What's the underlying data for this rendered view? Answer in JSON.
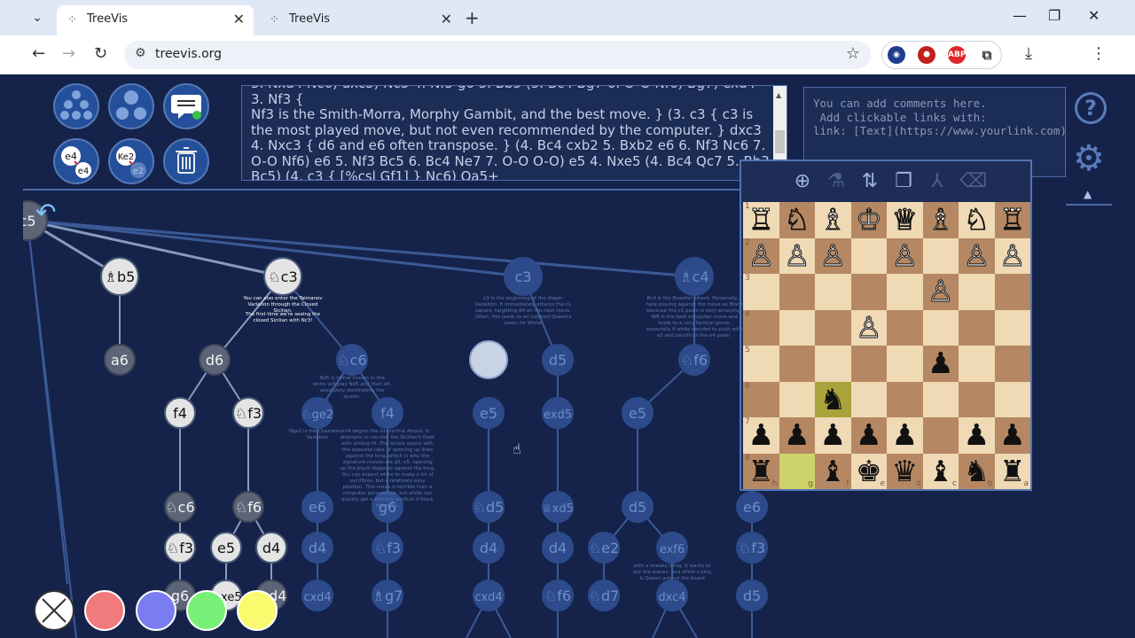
{
  "browser": {
    "tabs": [
      {
        "title": "TreeVis",
        "active": true
      },
      {
        "title": "TreeVis",
        "active": false
      }
    ],
    "url": "treevis.org",
    "window_controls": [
      "minimize-icon",
      "restore-icon",
      "close-icon"
    ],
    "extensions": [
      "privacy-badger-icon",
      "ublock-icon",
      "adblock-plus-icon",
      "puzzle-extensions-icon"
    ]
  },
  "app": {
    "toolbar": [
      {
        "name": "tree-layout-icon"
      },
      {
        "name": "bubble-layout-icon"
      },
      {
        "name": "comments-toggle-icon"
      },
      {
        "name": "e4-e4-icon",
        "label_a": "e4",
        "label_b": "e4"
      },
      {
        "name": "ke2-e2-icon",
        "label_a": "Ke2",
        "label_b": "e2"
      },
      {
        "name": "trash-icon"
      }
    ],
    "pgn_text_hidden_line": "3. Nxd4 Nc6) dxc3) Nc3 4. Nf3 g6 5. Bb5 (5. Bc4 Bg7 6. O-O Nf6) Bg7) exd4 3. Nf3 {",
    "pgn_text": "Nf3 is the Smith-Morra, Morphy Gambit, and the best move. } (3. c3 { c3 is the most played move, but not even recommended by the computer. } dxc3 4. Nxc3 { d6 and e6 often transpose. } (4. Bc4 cxb2 5. Bxb2 e6 6. Nf3 Nc6 7. O-O Nf6) e6 5. Nf3 Bc5 6. Bc4 Ne7 7. O-O O-O) e5 4. Nxe5 (4. Bc4 Qc7 5. Bb3 Bc5) (4. c3 { [%csl Gf1] } Nc6) Qa5+",
    "comment_placeholder": "You can add comments here.\n Add clickable links with:\nlink: [Text](https://www.yourlink.com)",
    "help_label": "?",
    "tree": {
      "root_label": "c5",
      "nodes": [
        {
          "id": "n1",
          "label": "♗b5",
          "style": "w"
        },
        {
          "id": "n2",
          "label": "♘c3",
          "style": "w"
        },
        {
          "id": "n3",
          "label": "c3",
          "style": "f"
        },
        {
          "id": "n4",
          "label": "♗c4",
          "style": "f"
        },
        {
          "id": "n5",
          "label": "a6",
          "style": "d"
        },
        {
          "id": "n6",
          "label": "d6",
          "style": "d"
        },
        {
          "id": "n7",
          "label": "♘c6",
          "style": "f"
        },
        {
          "id": "n8",
          "label": "d5",
          "style": "f"
        },
        {
          "id": "n9",
          "label": "♘f6",
          "style": "f"
        },
        {
          "id": "n10",
          "label": "f4",
          "style": "w"
        },
        {
          "id": "n11",
          "label": "♘f3",
          "style": "w"
        },
        {
          "id": "n12",
          "label": "♘ge2",
          "style": "f"
        },
        {
          "id": "n13",
          "label": "f4",
          "style": "f"
        },
        {
          "id": "n14",
          "label": "e5",
          "style": "f"
        },
        {
          "id": "n15",
          "label": "exd5",
          "style": "f"
        },
        {
          "id": "n16",
          "label": "e5",
          "style": "f"
        },
        {
          "id": "n17",
          "label": "♘c6",
          "style": "d"
        },
        {
          "id": "n18",
          "label": "♘f6",
          "style": "d"
        },
        {
          "id": "n19",
          "label": "e6",
          "style": "f"
        },
        {
          "id": "n20",
          "label": "g6",
          "style": "f"
        },
        {
          "id": "n21",
          "label": "♘d5",
          "style": "f"
        },
        {
          "id": "n22",
          "label": "♕xd5",
          "style": "f"
        },
        {
          "id": "n23",
          "label": "d5",
          "style": "f"
        },
        {
          "id": "n24",
          "label": "e6",
          "style": "f"
        },
        {
          "id": "n25",
          "label": "♘f3",
          "style": "w"
        },
        {
          "id": "n26",
          "label": "e5",
          "style": "w"
        },
        {
          "id": "n27",
          "label": "d4",
          "style": "w"
        },
        {
          "id": "n28",
          "label": "d4",
          "style": "f"
        },
        {
          "id": "n29",
          "label": "♘f3",
          "style": "f"
        },
        {
          "id": "n30",
          "label": "d4",
          "style": "f"
        },
        {
          "id": "n31",
          "label": "d4",
          "style": "f"
        },
        {
          "id": "n32",
          "label": "♘e2",
          "style": "f"
        },
        {
          "id": "n33",
          "label": "exf6",
          "style": "f"
        },
        {
          "id": "n34",
          "label": "♘f3",
          "style": "f"
        },
        {
          "id": "n35",
          "label": "g6",
          "style": "d"
        },
        {
          "id": "n36",
          "label": "♘xe5",
          "style": "w"
        },
        {
          "id": "n37",
          "label": "♘d4",
          "style": "d"
        },
        {
          "id": "n38",
          "label": "cxd4",
          "style": "f"
        },
        {
          "id": "n39",
          "label": "♗g7",
          "style": "f"
        },
        {
          "id": "n40",
          "label": "cxd4",
          "style": "f"
        },
        {
          "id": "n41",
          "label": "♘f6",
          "style": "f"
        },
        {
          "id": "n42",
          "label": "♘d7",
          "style": "f"
        },
        {
          "id": "n43",
          "label": "dxc4",
          "style": "f"
        },
        {
          "id": "n44",
          "label": "d5",
          "style": "f"
        }
      ],
      "annotations": [
        {
          "id": "a1",
          "text": "You can also enter the Taimanov Variation through the Closed Sicilian."
        },
        {
          "id": "a2",
          "text": "The first time we're seeing the closed Sicilian with Nc3!"
        },
        {
          "id": "a3",
          "text": "c3 is the beginning of the Alapin Variation. It immediately attacks the c1 square, targeting d4 on the next move. Often, this leads to an isolated Queen's pawn for White"
        },
        {
          "id": "a4",
          "text": "Bc4 is the Bowdler attack. Personally, I hate playing against the move as Black because the c5 pawn is very annoying. Nf6 is the best computer move and leads to a very tactical game, especially if white decides to push with e5 and sacrifices the e4 pawn."
        },
        {
          "id": "a5",
          "text": "Nd5 is rather known in the white will play Nd5 and then d4, absolutely dominating the queen."
        },
        {
          "id": "a6",
          "text": "Nge2 is the Chameleon Variation"
        },
        {
          "id": "a7",
          "text": "f4 begins the Grand Prix Attack. It attempts to counter the Sicilian's flank with aiming f4. The attack opens with the opposite idea of opening up lines against the king, which is why the signature moves are g5, e5, opening up the black diagonal against the king. You can expect white to make a lot of sacrifices, but a relatively easy position. This move is terrible from a computer perspective, but white can quickly get a winning position if black misplays."
        },
        {
          "id": "a8",
          "text": "with a sneaky thing. It wants to put the pieces, and white's king & Queen around the board"
        }
      ]
    },
    "chess_tools": [
      "zoom-in-icon",
      "analysis-microscope-icon",
      "flip-board-icon",
      "copy-fen-icon",
      "branch-icon",
      "delete-branch-icon"
    ],
    "board_ranks": [
      "1",
      "2",
      "3",
      "4",
      "5",
      "6",
      "7",
      "8"
    ],
    "board_files": [
      "h",
      "g",
      "f",
      "e",
      "d",
      "c",
      "b",
      "a"
    ],
    "board": [
      [
        "♖",
        "♘",
        "♗",
        "♔",
        "♕",
        "♗",
        "♘",
        "♖"
      ],
      [
        "♙",
        "♙",
        "♙",
        "",
        "♙",
        "",
        "♙",
        "♙"
      ],
      [
        "",
        "",
        "",
        "",
        "",
        "♙",
        "",
        ""
      ],
      [
        "",
        "",
        "",
        "♙",
        "",
        "",
        "",
        ""
      ],
      [
        "",
        "",
        "",
        "",
        "",
        "♟",
        "",
        ""
      ],
      [
        "",
        "",
        "♞",
        "",
        "",
        "",
        "",
        ""
      ],
      [
        "♟",
        "♟",
        "♟",
        "♟",
        "♟",
        "",
        "♟",
        "♟"
      ],
      [
        "♜",
        "",
        "♝",
        "♚",
        "♛",
        "♝",
        "♞",
        "♜"
      ]
    ],
    "highlights": {
      "hl": [
        [
          5,
          2
        ]
      ],
      "hl2": [
        [
          7,
          1
        ]
      ]
    },
    "colors": [
      {
        "name": "clear-color",
        "color": "#ffffff"
      },
      {
        "name": "red-color",
        "color": "#f07a7c"
      },
      {
        "name": "blue-color",
        "color": "#7a7cf2"
      },
      {
        "name": "green-color",
        "color": "#78f078"
      },
      {
        "name": "yellow-color",
        "color": "#fafa6e"
      }
    ]
  }
}
